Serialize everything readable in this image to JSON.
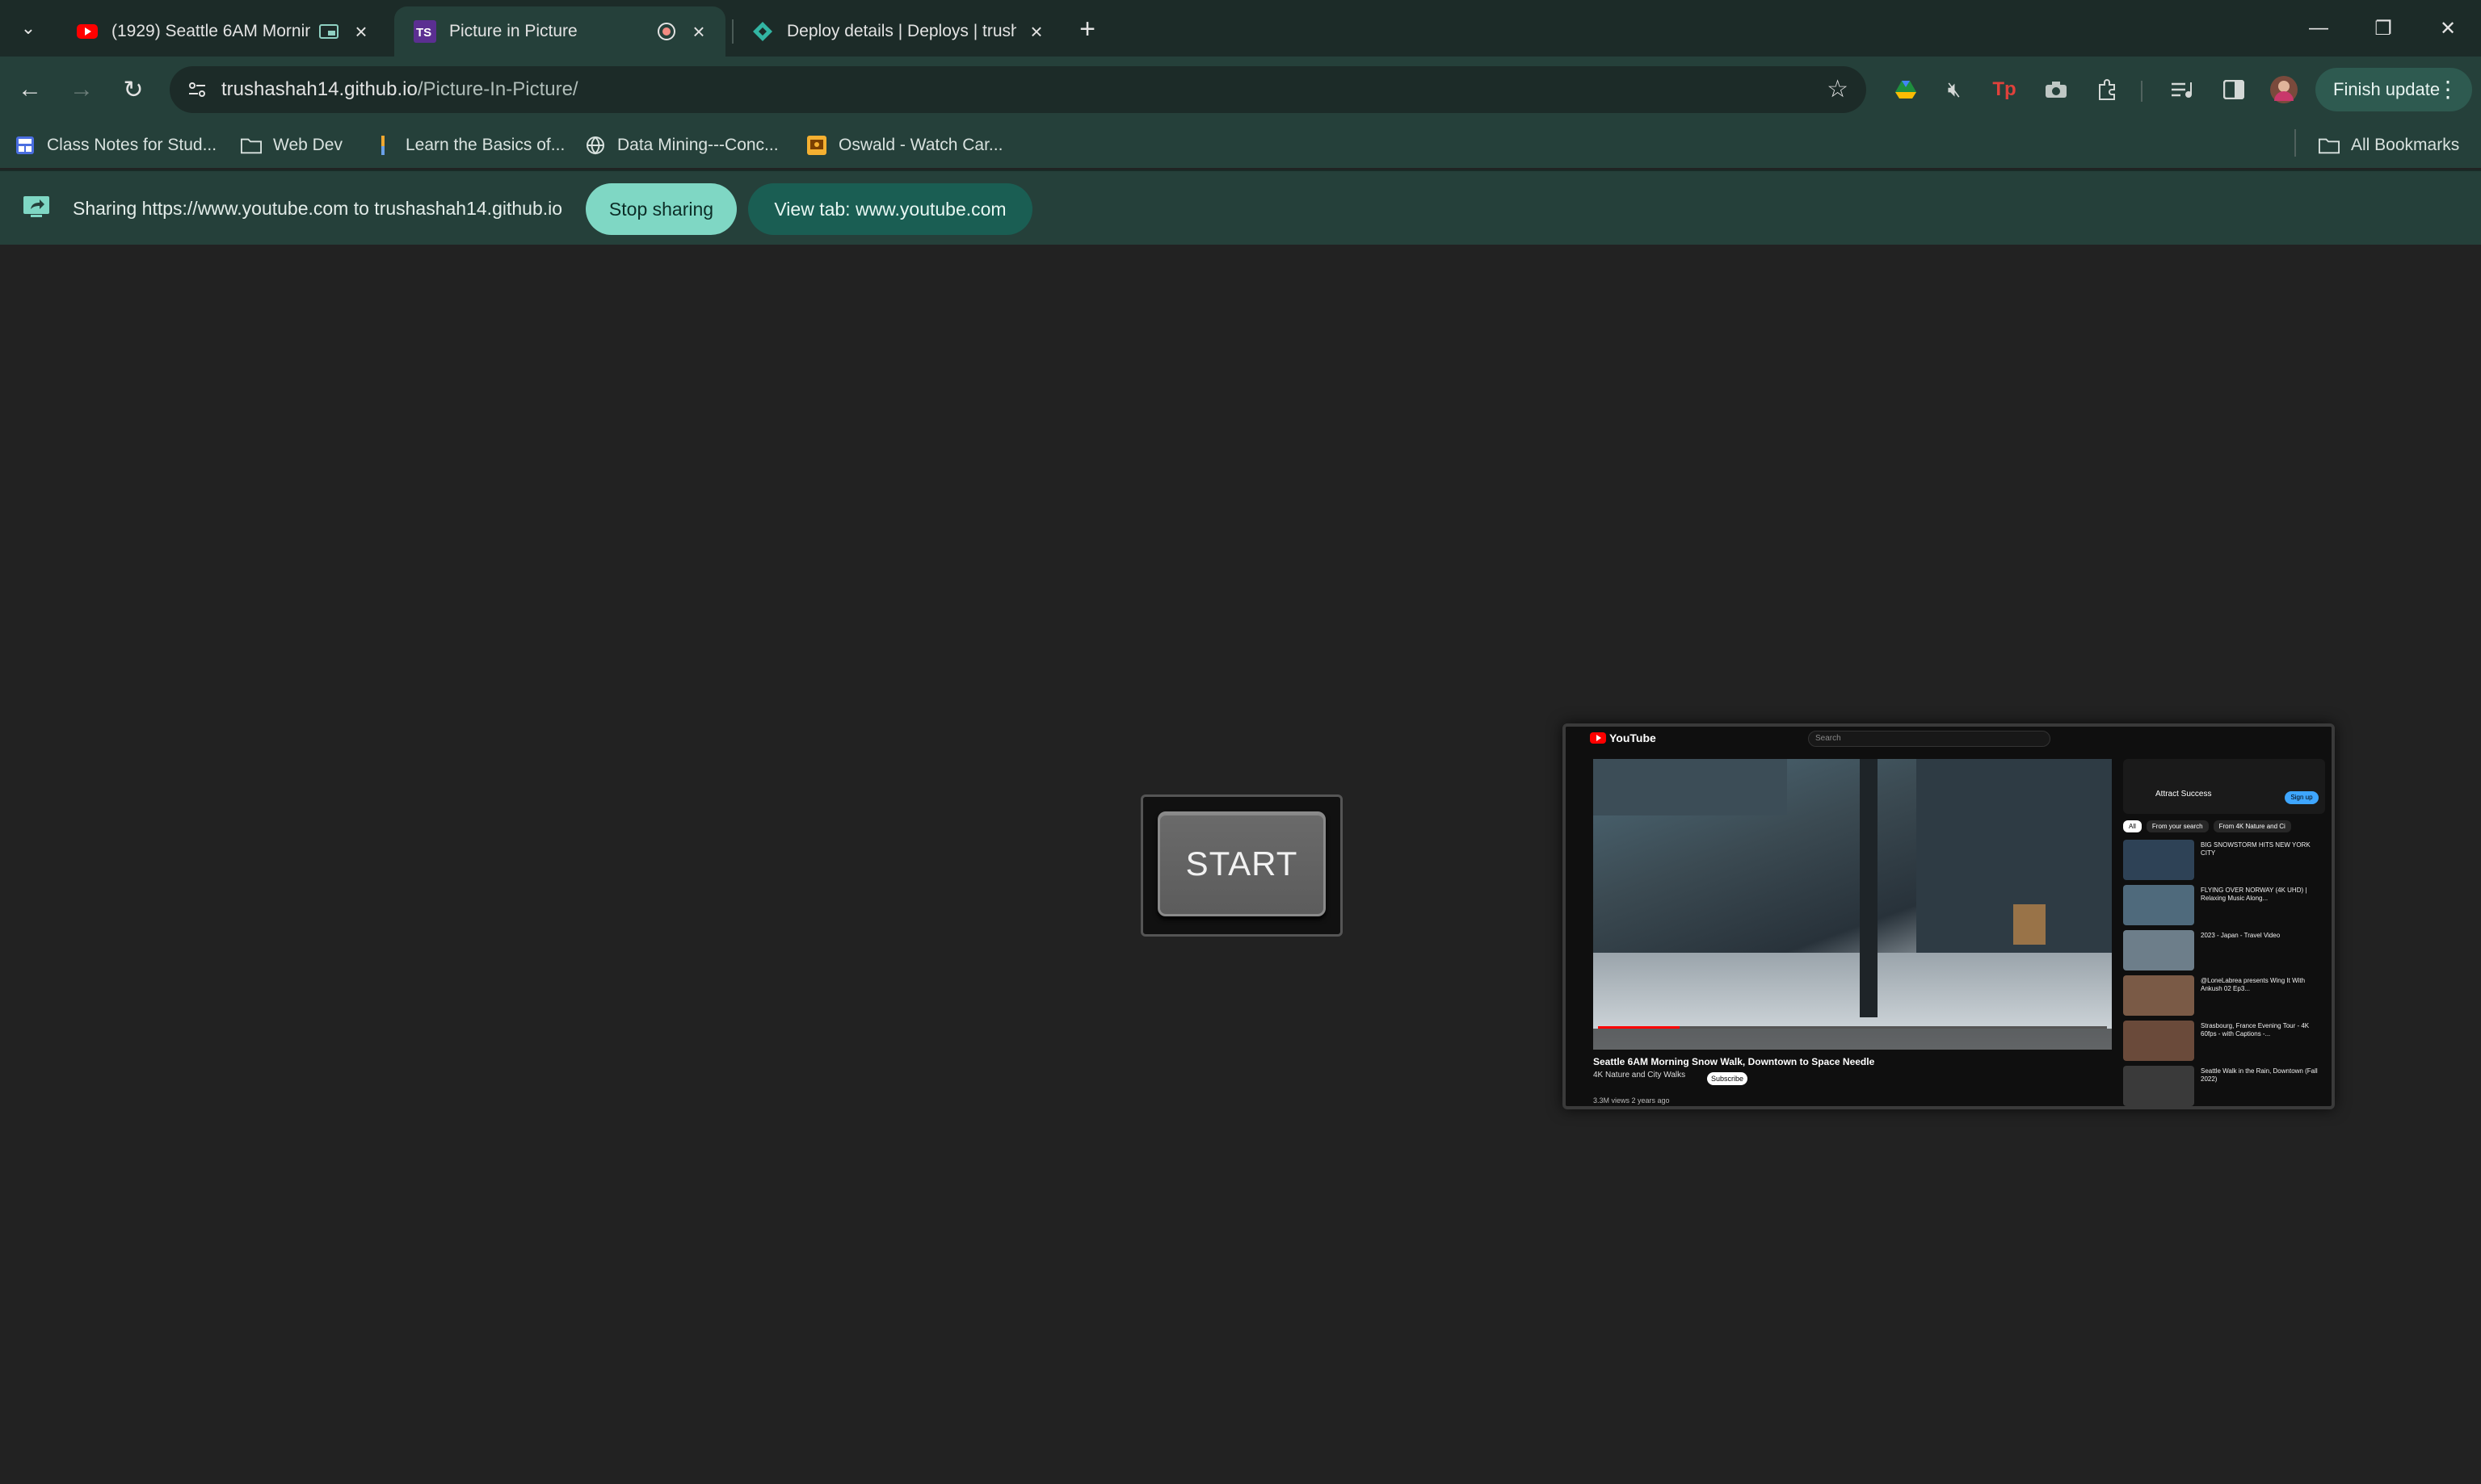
{
  "tabs": [
    {
      "title": "(1929) Seattle 6AM Morning",
      "active": false,
      "state_icon": "picture-in-picture-icon"
    },
    {
      "title": "Picture in Picture",
      "active": true,
      "favicon_text": "TS",
      "state_icon": "screen-sharing-icon"
    },
    {
      "title": "Deploy details | Deploys | trush",
      "active": false
    }
  ],
  "toolbar": {
    "url_host": "trushashah14.github.io",
    "url_path": "/Picture-In-Picture/",
    "finish_update_label": "Finish update"
  },
  "bookmarks": {
    "items": [
      {
        "label": "Class Notes for Stud...",
        "icon": "docs-icon"
      },
      {
        "label": "Web Dev",
        "icon": "folder-icon"
      },
      {
        "label": "Learn the Basics of...",
        "icon": "bar-icon"
      },
      {
        "label": "Data Mining---Conc...",
        "icon": "globe-icon"
      },
      {
        "label": "Oswald - Watch Car...",
        "icon": "video-site-icon"
      }
    ],
    "all_bookmarks_label": "All Bookmarks"
  },
  "infobar": {
    "message": "Sharing https://www.youtube.com to trushashah14.github.io",
    "stop_label": "Stop sharing",
    "view_label": "View tab: www.youtube.com"
  },
  "page": {
    "start_label": "START"
  },
  "pip_preview": {
    "logo_text": "YouTube",
    "search_placeholder": "Search",
    "video_title": "Seattle 6AM Morning Snow Walk, Downtown to Space Needle",
    "channel": "4K Nature and City Walks",
    "subscribe_label": "Subscribe",
    "views": "3.3M views  2 years ago",
    "ad_title": "Attract Success",
    "ad_signup": "Sign up",
    "chips": [
      "All",
      "From your search",
      "From 4K Nature and Ci"
    ],
    "recommendations": [
      {
        "title": "BIG SNOWSTORM HITS NEW YORK CITY",
        "color": "#2e4256"
      },
      {
        "title": "FLYING OVER NORWAY (4K UHD) | Relaxing Music Along...",
        "color": "#4f6a7c"
      },
      {
        "title": "2023 - Japan - Travel Video",
        "color": "#6d7e8a"
      },
      {
        "title": "@LoneLabrea presents Wing It With Ankush 02 Ep3...",
        "color": "#7a5a46"
      },
      {
        "title": "Strasbourg, France Evening Tour - 4K 60fps - with Captions -...",
        "color": "#6a4a3a"
      },
      {
        "title": "Seattle Walk in the Rain, Downtown (Fall 2022)",
        "color": "#3a3a3a"
      }
    ]
  },
  "colors": {
    "tab_strip": "#1c2b28",
    "toolbar": "#25403a",
    "stop_button": "#7fd7c4",
    "view_button": "#1a5e53",
    "page_bg": "#222222"
  }
}
